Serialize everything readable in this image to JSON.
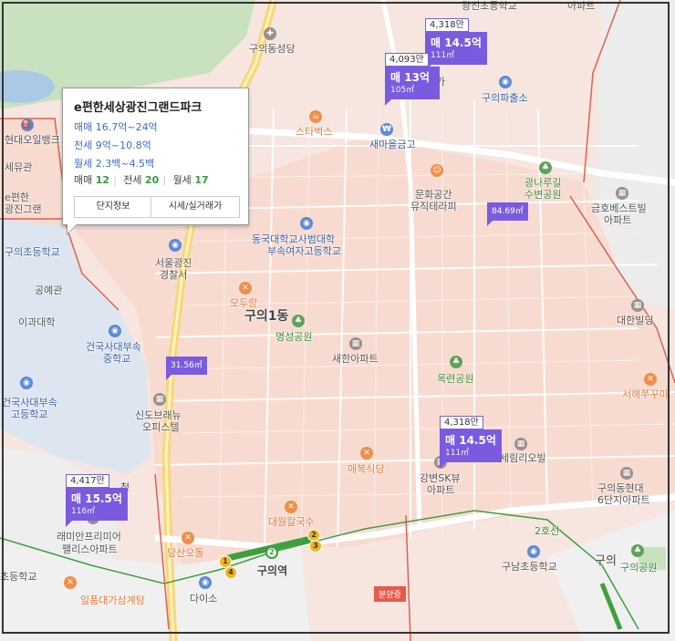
{
  "popup": {
    "title": "e편한세상광진그랜드파크",
    "sale": "매매 16.7억~24억",
    "jeonse": "전세 9억~10.8억",
    "wolse": "월세 2.3백~4.5백",
    "count_sale_label": "매매",
    "count_sale": "12",
    "count_jeonse_label": "전세",
    "count_jeonse": "20",
    "count_wolse_label": "월세",
    "count_wolse": "17",
    "btn_info": "단지정보",
    "btn_price": "시세/실거래가"
  },
  "markers": [
    {
      "count": "4,318만",
      "price": "매 14.5억",
      "area": "111㎡"
    },
    {
      "count": "4,093만",
      "price": "매 13억",
      "area": "105㎡"
    },
    {
      "count": "4,318만",
      "price": "매 14.5억",
      "area": "111㎡"
    },
    {
      "count": "4,417만",
      "price": "매 15.5억",
      "area": "116㎡"
    }
  ],
  "mini_markers": [
    "84.69㎡",
    "31.56㎡"
  ],
  "red_tag": "분양중",
  "labels": {
    "school_top": "광진초등학교",
    "apt_top": "아파트",
    "seongdang": "구의동성당",
    "ga": "가",
    "uipost": "구의파출소",
    "starbucks": "스타벅스",
    "saemaeul": "새마을금고",
    "hyundai_oil": "현대오일뱅크",
    "sebu": "세뮤관",
    "epyeon_l1": "e편한",
    "epyeon_l2": "광진그랜",
    "gwangnaru_l1": "광나루길",
    "gwangnaru_l2": "수변공원",
    "munhwa_l1": "문화공간",
    "munhwa_l2": "뮤직테라피",
    "geumho_l1": "금호베스트빌",
    "geumho_l2": "아파트",
    "guui_school": "구의초등학교",
    "dongguk_l1": "동국대학교사범대학",
    "dongguk_l2": "부속여자고등학교",
    "police_l1": "서울광진",
    "police_l2": "경찰서",
    "gongmi": "공예관",
    "modu": "모두랑",
    "district": "구의1동",
    "daehan": "대한빌딩",
    "ihwa": "이과대학",
    "konkuk_mid_l1": "건국사대부속",
    "konkuk_mid_l2": "중학교",
    "myeongseong": "명성공원",
    "saehan": "새한아파트",
    "mokryeon": "목련공원",
    "seohae": "서해쭈꾸미",
    "konkuk_hi_l1": "건국사대부속",
    "konkuk_hi_l2": "고등학교",
    "sindo_l1": "신도브래뉴",
    "sindo_l2": "오피스텔",
    "maebok": "매복식당",
    "serim": "세림리오빌",
    "gangbyeon_l1": "강변SK뷰",
    "gangbyeon_l2": "아파트",
    "guui_hyundai_l1": "구의동현대",
    "guui_hyundai_l2": "6단지아파트",
    "raemian_l1": "래미안프리미어",
    "raemian_l2": "팰리스아파트",
    "daewol": "대월칼국수",
    "dangsan": "당산오돌",
    "guui_station": "구의역",
    "line2": "2호선",
    "guyang": "구남초등학교",
    "guui_park": "구의공원",
    "guui_right": "구의",
    "ilpum": "일품대가삼계탕",
    "daiso": "다이소",
    "school_left": "초등학교",
    "cheong": "청"
  },
  "station_badges": [
    "1",
    "4",
    "2",
    "2",
    "3"
  ],
  "colors": {
    "marker": "#7a5be0",
    "road_yellow": "#f7d778",
    "boundary": "#e06050",
    "subway_green": "#3ca03c",
    "park_green": "#c8e2c0"
  }
}
